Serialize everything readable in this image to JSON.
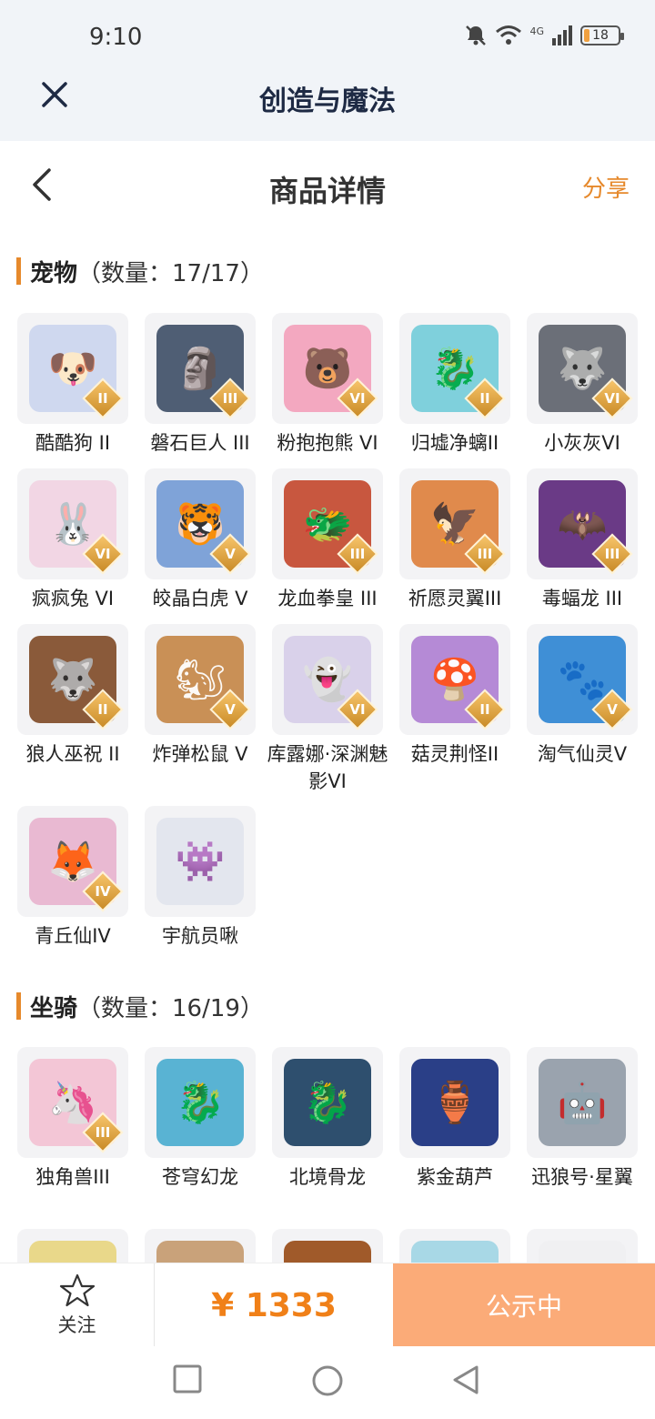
{
  "status": {
    "time": "9:10",
    "network": "4G",
    "battery": "18",
    "battery_level": 0.18
  },
  "app": {
    "title": "创造与魔法"
  },
  "nav": {
    "title": "商品详情",
    "share": "分享"
  },
  "pets": {
    "name": "宠物",
    "count": "（数量：17/17）",
    "items": [
      {
        "label": "酷酷狗 II",
        "badge": "II",
        "color": "#cfd8ef",
        "glyph": "🐶",
        "icon": "dog-pet-icon"
      },
      {
        "label": "磐石巨人 III",
        "badge": "III",
        "color": "#4f5e74",
        "glyph": "🗿",
        "icon": "stone-giant-icon"
      },
      {
        "label": "粉抱抱熊 VI",
        "badge": "VI",
        "color": "#f3a8c0",
        "glyph": "🐻",
        "icon": "pink-bear-icon"
      },
      {
        "label": "归墟净螭II",
        "badge": "II",
        "color": "#7fd0dc",
        "glyph": "🐉",
        "icon": "water-dragon-icon"
      },
      {
        "label": "小灰灰VI",
        "badge": "VI",
        "color": "#6b6f78",
        "glyph": "🐺",
        "icon": "grey-wolf-icon"
      },
      {
        "label": "疯疯兔 VI",
        "badge": "VI",
        "color": "#f2d6e4",
        "glyph": "🐰",
        "icon": "rabbit-pet-icon"
      },
      {
        "label": "皎晶白虎 V",
        "badge": "V",
        "color": "#7fa3d8",
        "glyph": "🐯",
        "icon": "white-tiger-icon"
      },
      {
        "label": "龙血拳皇 III",
        "badge": "III",
        "color": "#c8573f",
        "glyph": "🐲",
        "icon": "dragon-king-icon"
      },
      {
        "label": "祈愿灵翼III",
        "badge": "III",
        "color": "#e08a4c",
        "glyph": "🦅",
        "icon": "spirit-wing-icon"
      },
      {
        "label": "毒蝠龙 III",
        "badge": "III",
        "color": "#6a3a86",
        "glyph": "🦇",
        "icon": "bat-dragon-icon"
      },
      {
        "label": "狼人巫祝 II",
        "badge": "II",
        "color": "#8a5a3a",
        "glyph": "🐺",
        "icon": "werewolf-icon"
      },
      {
        "label": "炸弹松鼠 V",
        "badge": "V",
        "color": "#c99056",
        "glyph": "🐿",
        "icon": "squirrel-icon"
      },
      {
        "label": "库露娜·深渊魅影VI",
        "badge": "VI",
        "color": "#d9d1ea",
        "glyph": "👻",
        "icon": "abyss-phantom-icon"
      },
      {
        "label": "菇灵荆怪II",
        "badge": "II",
        "color": "#b58ad6",
        "glyph": "🍄",
        "icon": "mushroom-spirit-icon"
      },
      {
        "label": "淘气仙灵V",
        "badge": "V",
        "color": "#3f8fd6",
        "glyph": "🐾",
        "icon": "naughty-sprite-icon"
      },
      {
        "label": "青丘仙IV",
        "badge": "IV",
        "color": "#e9b9d2",
        "glyph": "🦊",
        "icon": "fox-fairy-icon"
      },
      {
        "label": "宇航员啾",
        "badge": "",
        "color": "#e3e6ee",
        "glyph": "👾",
        "icon": "astronaut-icon"
      }
    ]
  },
  "mounts": {
    "name": "坐骑",
    "count": "（数量：16/19）",
    "items": [
      {
        "label": "独角兽III",
        "badge": "III",
        "color": "#f3c6d6",
        "glyph": "🦄",
        "icon": "unicorn-icon"
      },
      {
        "label": "苍穹幻龙",
        "badge": "",
        "color": "#59b3d3",
        "glyph": "🐉",
        "icon": "sky-dragon-icon"
      },
      {
        "label": "北境骨龙",
        "badge": "",
        "color": "#2e4f6e",
        "glyph": "🐉",
        "icon": "bone-dragon-icon"
      },
      {
        "label": "紫金葫芦",
        "badge": "",
        "color": "#2a3f87",
        "glyph": "🏺",
        "icon": "gourd-icon"
      },
      {
        "label": "迅狼号·星翼",
        "badge": "",
        "color": "#9aa3ae",
        "glyph": "🤖",
        "icon": "mech-wolf-icon"
      },
      {
        "label": "",
        "badge": "",
        "color": "#e9d88a",
        "glyph": "",
        "icon": "mount-icon"
      },
      {
        "label": "",
        "badge": "",
        "color": "#c9a27a",
        "glyph": "",
        "icon": "mount-icon"
      },
      {
        "label": "",
        "badge": "",
        "color": "#a05a2a",
        "glyph": "",
        "icon": "mount-icon"
      },
      {
        "label": "",
        "badge": "",
        "color": "#a8d8e6",
        "glyph": "",
        "icon": "mount-icon"
      },
      {
        "label": "",
        "badge": "",
        "color": "#f0f0f2",
        "glyph": "",
        "icon": "mount-icon"
      }
    ]
  },
  "footer": {
    "follow": "关注",
    "price": "¥ 1333",
    "status": "公示中"
  }
}
